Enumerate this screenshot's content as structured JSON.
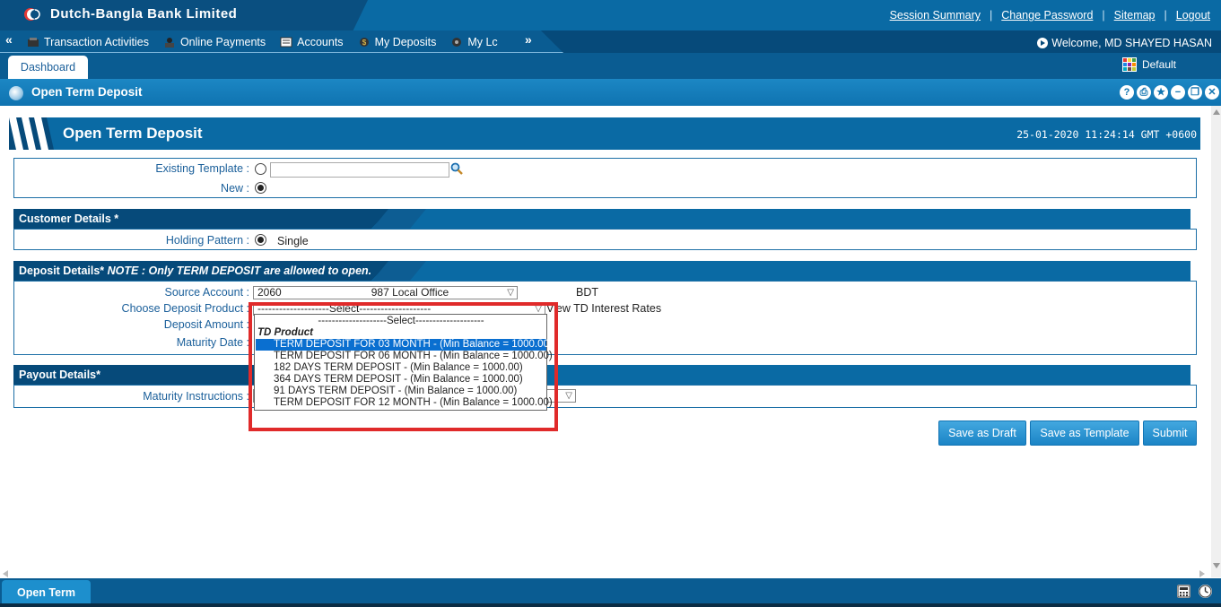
{
  "header": {
    "bank_name": "Dutch-Bangla Bank Limited",
    "links": [
      "Session Summary",
      "Change Password",
      "Sitemap",
      "Logout"
    ]
  },
  "menu": {
    "items": [
      "Transaction Activities",
      "Online Payments",
      "Accounts",
      "My Deposits",
      "My Lc"
    ],
    "welcome": "Welcome,  MD SHAYED  HASAN"
  },
  "tabs": {
    "dashboard": "Dashboard",
    "theme": "Default"
  },
  "section": {
    "title": "Open Term Deposit",
    "window_buttons": [
      "?",
      "⎙",
      "★",
      "−",
      "❐",
      "✕"
    ]
  },
  "form": {
    "title": "Open Term Deposit",
    "datetime": "25-01-2020 11:24:14 GMT +0600",
    "existing_template_label": "Existing Template :",
    "new_label": "New :",
    "template_search_value": ""
  },
  "customer": {
    "heading": "Customer Details *",
    "holding_label": "Holding Pattern :",
    "holding_value": "Single"
  },
  "deposit": {
    "heading": "Deposit Details*",
    "note": "NOTE : Only TERM DEPOSIT are allowed to open.",
    "source_account_label": "Source Account :",
    "source_account_value": "2060                              987 Local Office",
    "currency": "BDT",
    "product_label": "Choose Deposit Product :",
    "product_value": "--------------------Select--------------------",
    "view_rates_link": "View TD Interest Rates",
    "amount_label": "Deposit Amount :",
    "maturity_label": "Maturity Date :"
  },
  "dropdown": {
    "options": [
      "--------------------Select--------------------",
      "TD Product",
      "TERM DEPOSIT FOR 03 MONTH - (Min Balance = 1000.00)",
      "TERM DEPOSIT FOR 06 MONTH - (Min Balance = 1000.00)",
      "182 DAYS TERM DEPOSIT - (Min Balance = 1000.00)",
      "364 DAYS TERM DEPOSIT - (Min Balance = 1000.00)",
      "91 DAYS TERM DEPOSIT - (Min Balance = 1000.00)",
      "TERM DEPOSIT FOR 12 MONTH - (Min Balance = 1000.00)"
    ],
    "selected_index": 2
  },
  "payout": {
    "heading": "Payout Details*",
    "maturity_instructions_label": "Maturity Instructions :"
  },
  "buttons": {
    "save_draft": "Save as Draft",
    "save_template": "Save as Template",
    "submit": "Submit"
  },
  "footer": {
    "open_tab": "Open Term"
  },
  "colors": {
    "primary": "#0a6aa4",
    "dark": "#064a7a",
    "highlight": "#e02a2a",
    "selection": "#0a6fd0"
  }
}
